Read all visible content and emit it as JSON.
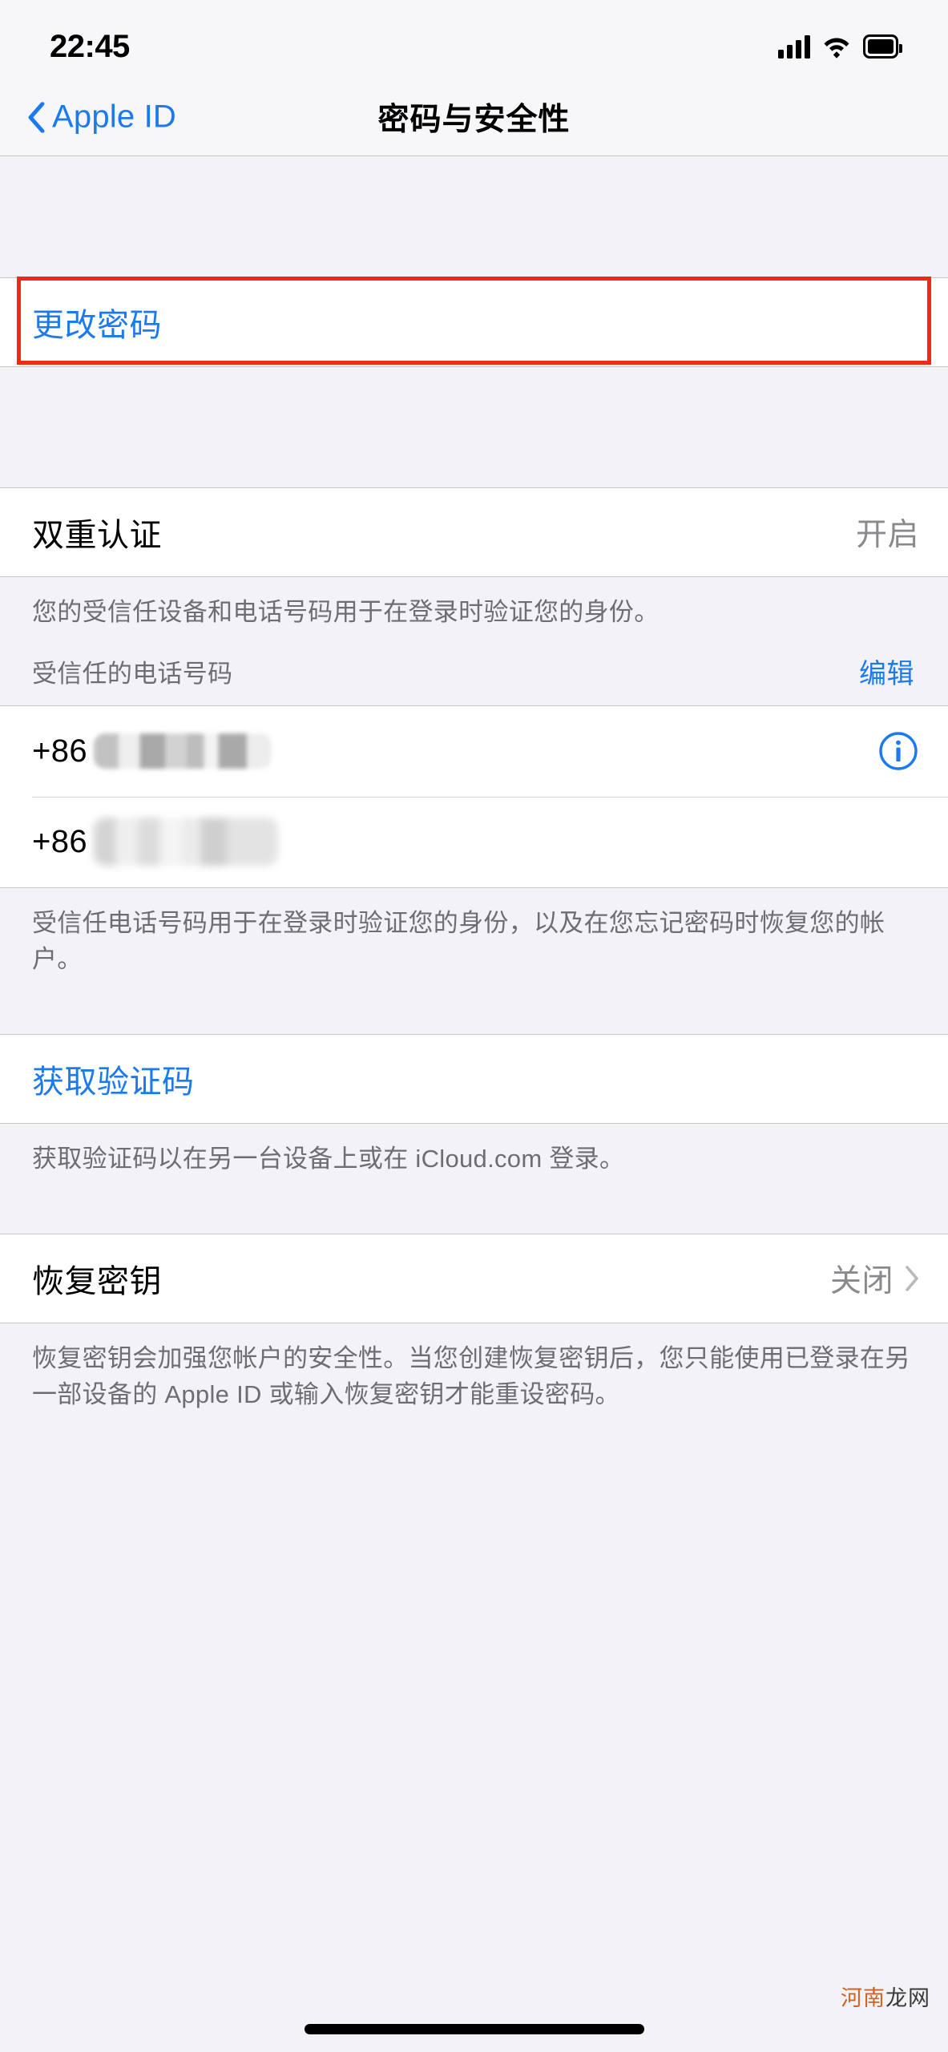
{
  "status_bar": {
    "time": "22:45",
    "icons": [
      "cellular-signal-icon",
      "wifi-icon",
      "battery-icon"
    ]
  },
  "nav": {
    "back_label": "Apple ID",
    "back_icon": "chevron-left-icon",
    "title": "密码与安全性"
  },
  "sections": {
    "change_password": {
      "label": "更改密码",
      "highlighted": true,
      "highlight_color": "#ee2a17"
    },
    "two_factor": {
      "title": "双重认证",
      "value": "开启",
      "footer": "您的受信任设备和电话号码用于在登录时验证您的身份。"
    },
    "trusted_numbers": {
      "header_label": "受信任的电话号码",
      "header_action": "编辑",
      "rows": [
        {
          "prefix": "+86",
          "number_redacted": true,
          "accessory": "info-icon"
        },
        {
          "prefix": "+86",
          "number_redacted": true,
          "accessory": "none"
        }
      ],
      "footer": "受信任电话号码用于在登录时验证您的身份，以及在您忘记密码时恢复您的帐户。"
    },
    "verification_code": {
      "label": "获取验证码",
      "footer": "获取验证码以在另一台设备上或在 iCloud.com 登录。"
    },
    "recovery_key": {
      "title": "恢复密钥",
      "value": "关闭",
      "accessory": "chevron-right-icon",
      "footer": "恢复密钥会加强您帐户的安全性。当您创建恢复密钥后，您只能使用已登录在另一部设备的 Apple ID 或输入恢复密钥才能重设密码。"
    }
  },
  "watermark": {
    "part_a": "河南",
    "part_b": "龙网",
    "color_a": "#d4621f",
    "color_b": "#3a3a3a"
  },
  "theme": {
    "background": "#f2f2f7",
    "card": "#ffffff",
    "accent_blue": "#1b7aed",
    "secondary_text": "#8a8a8e",
    "footer_text": "#6d6d72"
  }
}
